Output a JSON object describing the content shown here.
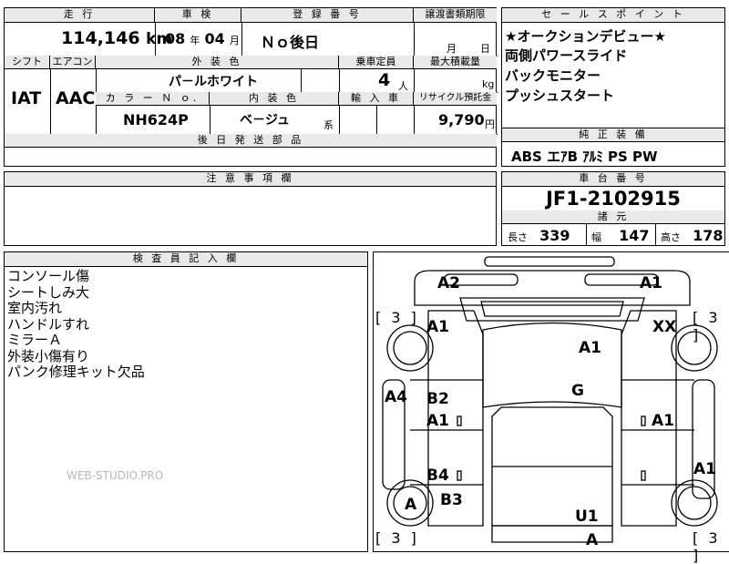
{
  "headers": {
    "mileage": "走 行",
    "inspection": "車 検",
    "registration": "登 録 番 号",
    "transfer_deadline": "譲渡書類期限",
    "sale_points": "セ ー ル ス ポ イ ン ト",
    "shift": "シフト",
    "aircon": "エアコン",
    "exterior_color": "外 装 色",
    "capacity": "乗車定員",
    "max_load": "最大積載量",
    "color_no": "カ ラ ー Ｎ ｏ.",
    "interior_color": "内 装 色",
    "import": "輸 入 車",
    "recycle": "リサイクル預託金",
    "later_parts": "後 日 発 送 部 品",
    "genuine_equipment": "純 正 装 備",
    "caution": "注 意 事 項 欄",
    "chassis_no": "車 台 番 号",
    "specs": "諸 元",
    "inspector": "検 査 員 記 入 欄"
  },
  "values": {
    "mileage": "114,146",
    "mileage_unit": "km",
    "inspection_year": "08",
    "year_unit": "年",
    "inspection_month": "04",
    "month_unit": "月",
    "registration": "Ｎｏ後日",
    "deadline_month": "月",
    "deadline_day": "日",
    "shift": "IAT",
    "aircon": "AAC",
    "exterior_color": "パ－ルホワイト",
    "capacity": "4",
    "capacity_unit": "人",
    "load_unit": "kg",
    "color_no": "NH624P",
    "interior_color": "ベ－ジュ",
    "interior_suffix": "系",
    "recycle": "9,790",
    "recycle_unit": "円",
    "chassis_no": "JF1-2102915"
  },
  "sale_points": [
    "★オークションデビュー★",
    "両側パワースライド",
    "バックモニター",
    "プッシュスタート"
  ],
  "equipment": "ABS エｱB ｱﾙﾐ PS PW",
  "specs": {
    "length_label": "長さ",
    "length": "339",
    "width_label": "幅",
    "width": "147",
    "height_label": "高さ",
    "height": "178"
  },
  "inspector_notes": [
    "コンソール傷",
    "シートしみ大",
    "室内汚れ",
    "ハンドルすれ",
    "ミラーＡ",
    "外装小傷有り",
    "パンク修理キット欠品"
  ],
  "watermark": "WEB-STUDIO.PRO",
  "diagram": {
    "tire_fl": "[ 3 ]",
    "tire_fr": "[ 3 ]",
    "tire_rl": "[ 3 ]",
    "tire_rr": "[ 3 ]",
    "marks": {
      "a2": "A2",
      "a1_top_right": "A1",
      "a1_left_fender": "A1",
      "xx": "XX",
      "a1_hood": "A1",
      "a4": "A4",
      "b2": "B2",
      "g": "G",
      "a1_front_door": "A1",
      "a1_right_door": "A1",
      "b4": "B4",
      "a1_right_rear": "A1",
      "a_tire": "A",
      "b3": "B3",
      "u1": "U1",
      "a_bumper": "A"
    }
  }
}
